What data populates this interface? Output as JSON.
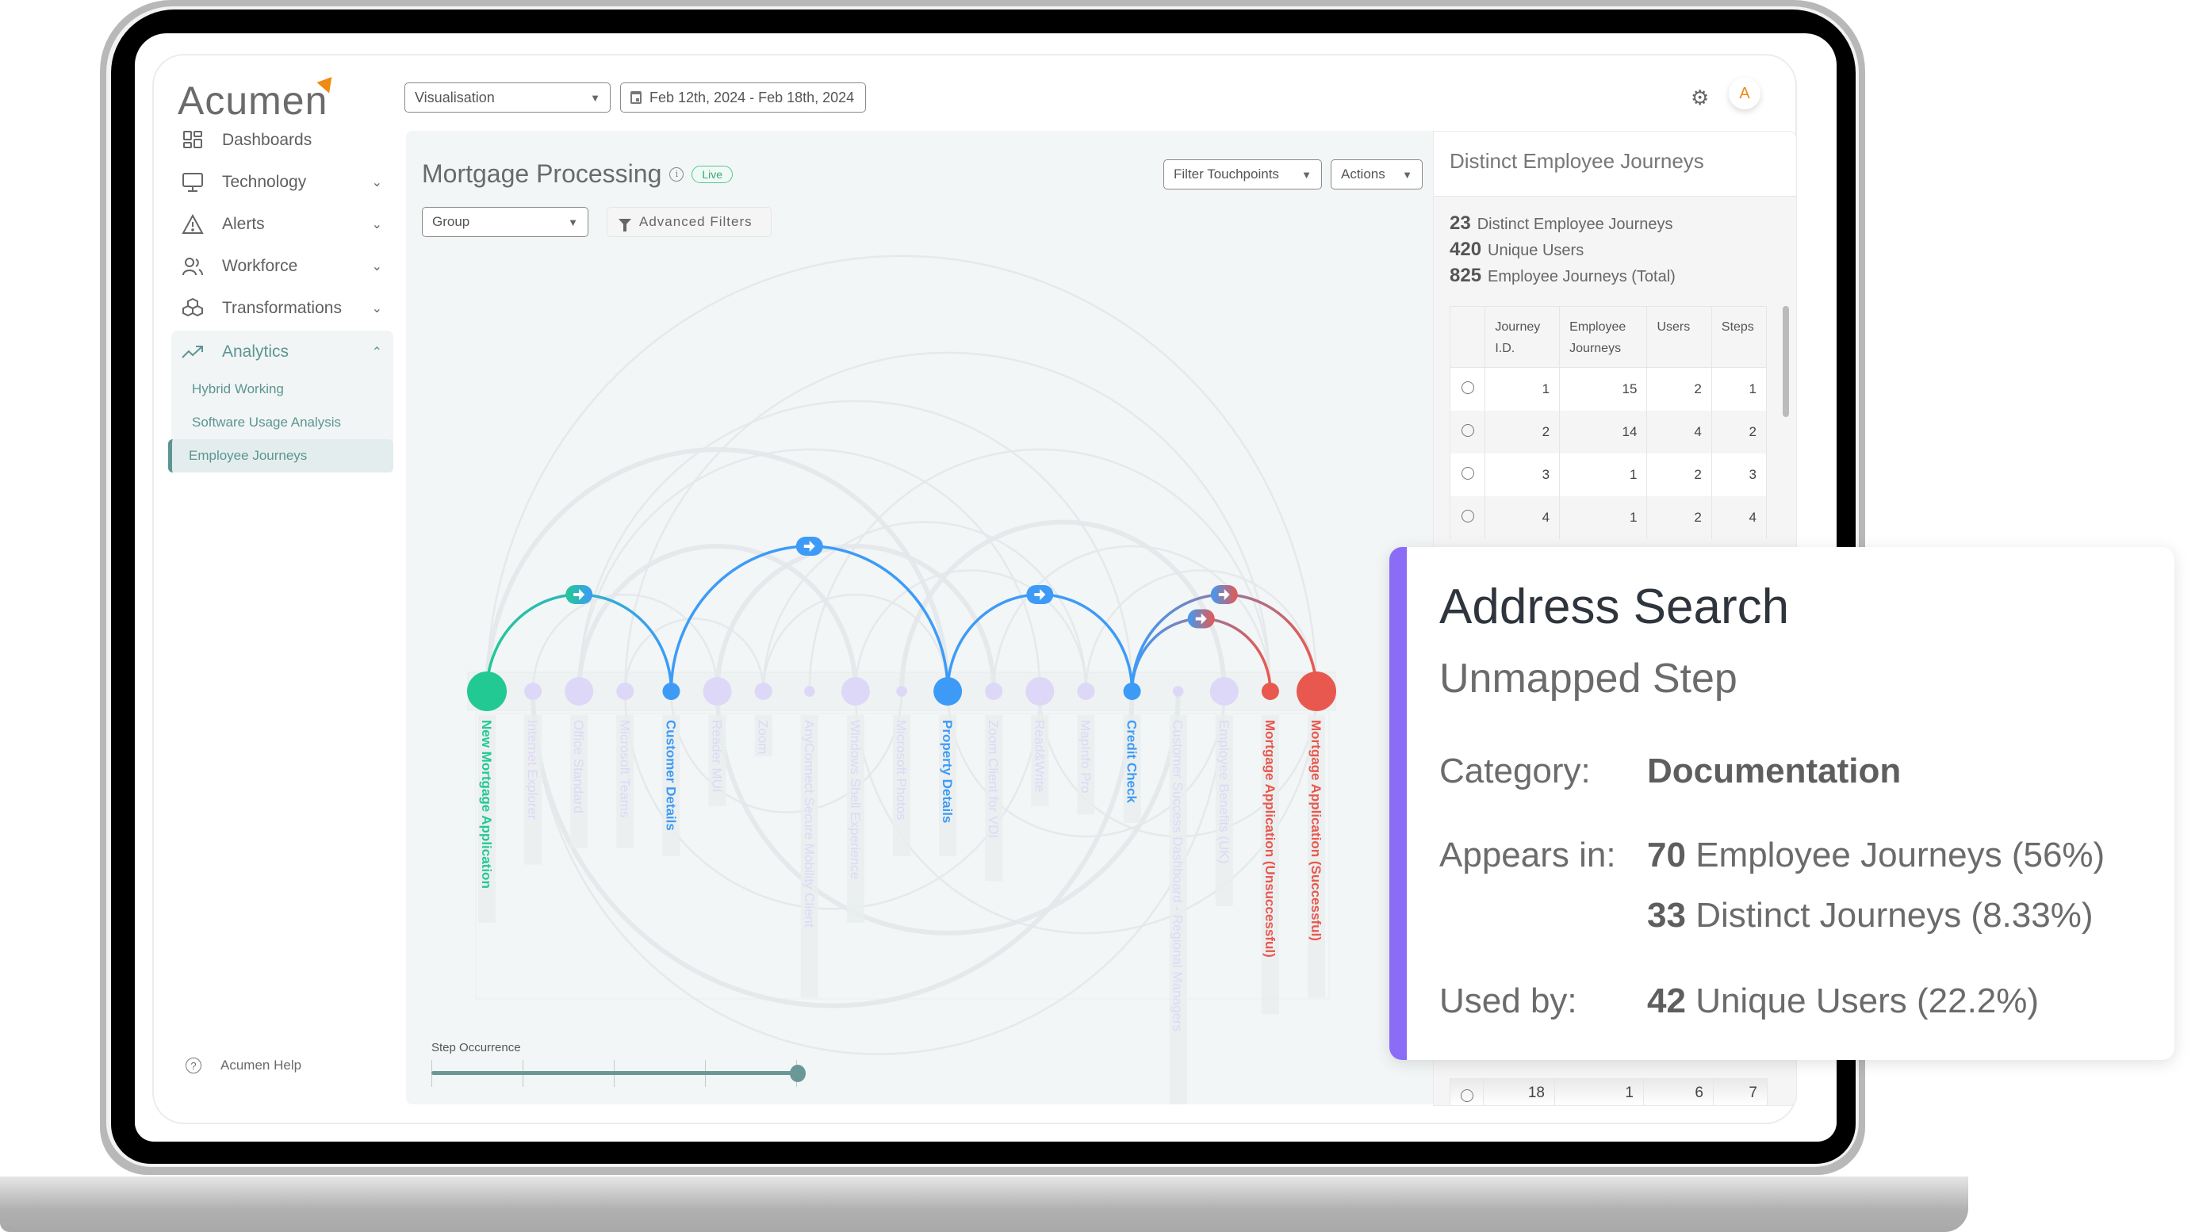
{
  "app": {
    "logo_text": "Acumen",
    "view_select": "Visualisation",
    "date_range": "Feb 12th, 2024 - Feb 18th, 2024",
    "avatar_initial": "A"
  },
  "sidebar": {
    "items": [
      {
        "label": "Dashboards",
        "icon": "grid-icon"
      },
      {
        "label": "Technology",
        "icon": "monitor-icon"
      },
      {
        "label": "Alerts",
        "icon": "warning-icon"
      },
      {
        "label": "Workforce",
        "icon": "users-icon"
      },
      {
        "label": "Transformations",
        "icon": "cubes-icon"
      },
      {
        "label": "Analytics",
        "icon": "trending-icon"
      }
    ],
    "analytics_sub": [
      "Hybrid Working",
      "Software Usage Analysis",
      "Employee Journeys"
    ],
    "active_sub": "Employee Journeys",
    "help_label": "Acumen Help"
  },
  "main": {
    "title": "Mortgage Processing",
    "live_badge": "Live",
    "filter_touchpoints": "Filter Touchpoints",
    "actions": "Actions",
    "group_select": "Group",
    "advanced_filters": "Advanced Filters",
    "step_occurrence_label": "Step Occurrence",
    "step_occurrence_value": 1.0
  },
  "chart_data": {
    "type": "arc-diagram",
    "title": "Mortgage Processing",
    "nodes": [
      {
        "label": "New Mortgage Application",
        "kind": "start",
        "color": "#22c993",
        "size": 3
      },
      {
        "label": "Internet Explorer",
        "kind": "unmapped",
        "size": 1
      },
      {
        "label": "Office Standard",
        "kind": "unmapped",
        "size": 2
      },
      {
        "label": "Microsoft Teams",
        "kind": "unmapped",
        "size": 1
      },
      {
        "label": "Customer Details",
        "kind": "mapped",
        "color": "#3d9bf7",
        "size": 1
      },
      {
        "label": "Reader MUI",
        "kind": "unmapped",
        "size": 2
      },
      {
        "label": "Zoom",
        "kind": "unmapped",
        "size": 1
      },
      {
        "label": "AnyConnect Secure Mobility Client",
        "kind": "unmapped",
        "size": 0.4
      },
      {
        "label": "Windows Shell Experience",
        "kind": "unmapped",
        "size": 2
      },
      {
        "label": "Microsoft Photos",
        "kind": "unmapped",
        "size": 0.4
      },
      {
        "label": "Property Details",
        "kind": "mapped",
        "color": "#3d9bf7",
        "size": 2
      },
      {
        "label": "Zoom Client for VDI",
        "kind": "unmapped",
        "size": 1
      },
      {
        "label": "Read&Write",
        "kind": "unmapped",
        "size": 2
      },
      {
        "label": "MapInfo Pro",
        "kind": "unmapped",
        "size": 1
      },
      {
        "label": "Credit Check",
        "kind": "mapped",
        "color": "#3d9bf7",
        "size": 1
      },
      {
        "label": "Customer Success Dashboard - Regional Managers",
        "kind": "unmapped",
        "size": 0.4
      },
      {
        "label": "Employee Benefits (UK)",
        "kind": "unmapped",
        "size": 2
      },
      {
        "label": "Mortgage Application (Unsuccessful)",
        "kind": "end",
        "color": "#e8584f",
        "size": 1
      },
      {
        "label": "Mortgage Application (Successful)",
        "kind": "end",
        "color": "#e8584f",
        "size": 3
      }
    ],
    "highlighted_links": [
      {
        "from": 0,
        "to": 4
      },
      {
        "from": 4,
        "to": 10
      },
      {
        "from": 10,
        "to": 14
      },
      {
        "from": 14,
        "to": 18
      },
      {
        "from": 14,
        "to": 17
      }
    ],
    "background_links": [
      [
        0,
        10
      ],
      [
        0,
        18
      ],
      [
        1,
        16
      ],
      [
        2,
        14
      ],
      [
        2,
        8
      ],
      [
        3,
        12
      ],
      [
        3,
        6
      ],
      [
        1,
        5
      ],
      [
        5,
        15
      ],
      [
        6,
        13
      ],
      [
        7,
        17
      ],
      [
        8,
        18
      ],
      [
        9,
        16
      ],
      [
        11,
        17
      ],
      [
        12,
        18
      ],
      [
        2,
        12
      ],
      [
        5,
        11
      ],
      [
        4,
        9
      ],
      [
        6,
        10
      ],
      [
        13,
        18
      ],
      [
        1,
        14
      ],
      [
        3,
        17
      ],
      [
        8,
        13
      ],
      [
        10,
        16
      ]
    ],
    "colors": {
      "unmapped": "#ddd8f7",
      "link_bg": "#e4e8ea"
    }
  },
  "summary": {
    "heading": "Distinct Employee Journeys",
    "stats": [
      {
        "value": "23",
        "label": "Distinct Employee Journeys"
      },
      {
        "value": "420",
        "label": "Unique Users"
      },
      {
        "value": "825",
        "label": "Employee Journeys (Total)"
      }
    ],
    "table": {
      "headers": [
        "Journey I.D.",
        "Employee Journeys",
        "Users",
        "Steps"
      ],
      "rows": [
        [
          "1",
          "15",
          "2",
          "1"
        ],
        [
          "2",
          "14",
          "4",
          "2"
        ],
        [
          "3",
          "1",
          "2",
          "3"
        ],
        [
          "4",
          "1",
          "2",
          "4"
        ]
      ],
      "last_visible_row": [
        "18",
        "1",
        "6",
        "7"
      ]
    }
  },
  "popup": {
    "title": "Address Search",
    "subtitle": "Unmapped Step",
    "category_label": "Category:",
    "category_value": "Documentation",
    "appears_label": "Appears in:",
    "appears_1_count": "70",
    "appears_1_text": "Employee Journeys (56%)",
    "appears_2_count": "33",
    "appears_2_text": "Distinct Journeys (8.33%)",
    "used_label": "Used by:",
    "used_count": "42",
    "used_text": "Unique Users (22.2%)",
    "accent": "#8b6cf6"
  }
}
